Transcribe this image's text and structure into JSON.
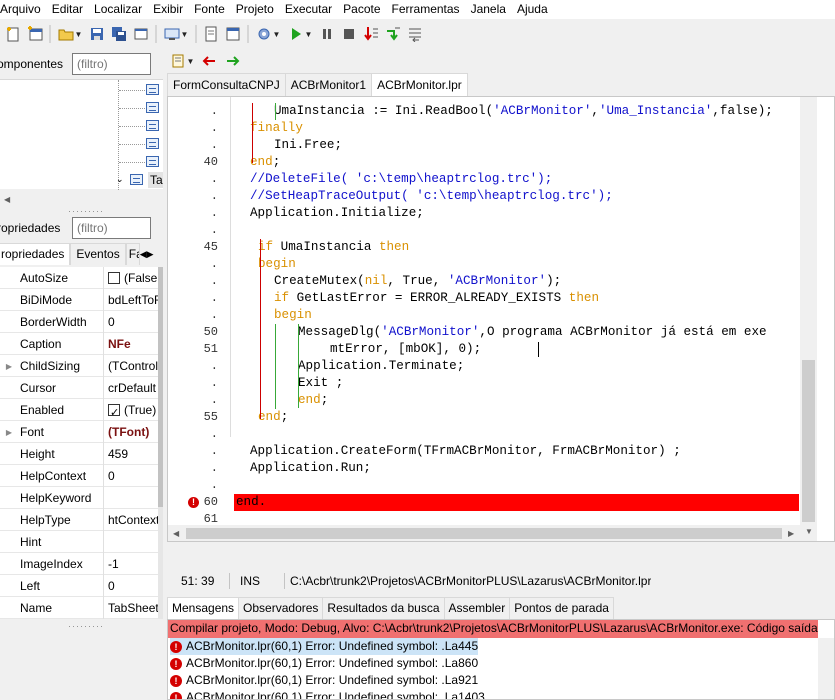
{
  "menu": [
    "Arquivo",
    "Editar",
    "Localizar",
    "Exibir",
    "Fonte",
    "Projeto",
    "Executar",
    "Pacote",
    "Ferramentas",
    "Janela",
    "Ajuda"
  ],
  "toolbar": {
    "icons": [
      "new-unit-icon",
      "new-form-icon",
      "open-icon",
      "save-icon",
      "save-all-icon",
      "toggle-form-icon",
      "view-units-icon",
      "view-forms-icon",
      "change-build-mode-icon",
      "run-icon",
      "pause-icon",
      "stop-icon",
      "step-into-icon",
      "step-over-icon",
      "step-out-icon"
    ]
  },
  "components": {
    "label": "omponentes",
    "filter_placeholder": "(filtro)",
    "last_node_label": "Ta"
  },
  "properties": {
    "label": "ropriedades",
    "filter_placeholder": "(filtro)",
    "tabs": [
      "ropriedades",
      "Eventos",
      "Fa"
    ],
    "rows": [
      {
        "name": "AutoSize",
        "value": "(False",
        "checkbox": "off",
        "expandable": false
      },
      {
        "name": "BiDiMode",
        "value": "bdLeftToR",
        "expandable": false
      },
      {
        "name": "BorderWidth",
        "value": "0",
        "expandable": false
      },
      {
        "name": "Caption",
        "value": "NFe",
        "bold": true,
        "expandable": false
      },
      {
        "name": "ChildSizing",
        "value": "(TControlC",
        "expandable": true
      },
      {
        "name": "Cursor",
        "value": "crDefault",
        "expandable": false
      },
      {
        "name": "Enabled",
        "value": "(True)",
        "checkbox": "on",
        "expandable": false
      },
      {
        "name": "Font",
        "value": "(TFont)",
        "bold": true,
        "expandable": true
      },
      {
        "name": "Height",
        "value": "459",
        "expandable": false
      },
      {
        "name": "HelpContext",
        "value": "0",
        "expandable": false
      },
      {
        "name": "HelpKeyword",
        "value": "",
        "expandable": false
      },
      {
        "name": "HelpType",
        "value": "htContext",
        "expandable": false
      },
      {
        "name": "Hint",
        "value": "",
        "expandable": false
      },
      {
        "name": "ImageIndex",
        "value": "-1",
        "expandable": false
      },
      {
        "name": "Left",
        "value": "0",
        "expandable": false
      },
      {
        "name": "Name",
        "value": "TabSheetI",
        "expandable": false
      }
    ]
  },
  "editor": {
    "tabs": [
      "FormConsultaCNPJ",
      "ACBrMonitor1",
      "ACBrMonitor.lpr"
    ],
    "active_tab": 2,
    "gutter": [
      ".",
      ".",
      ".",
      "40",
      ".",
      ".",
      ".",
      ".",
      "45",
      ".",
      ".",
      ".",
      ".",
      "50",
      "51",
      ".",
      ".",
      ".",
      "55",
      ".",
      ".",
      ".",
      ".",
      "60",
      "61"
    ],
    "error_line_number": "60",
    "error_line_text": "end.",
    "lines": [
      "UmaInstancia := Ini.ReadBool('ACBrMonitor','Uma_Instancia',false);",
      "finally",
      "Ini.Free;",
      "end;",
      "//DeleteFile( 'c:\\temp\\heaptrclog.trc');",
      "//SetHeapTraceOutput( 'c:\\temp\\heaptrclog.trc');",
      "Application.Initialize;",
      "",
      "if UmaInstancia then",
      "begin",
      "CreateMutex(nil, True, 'ACBrMonitor');",
      "if GetLastError = ERROR_ALREADY_EXISTS then",
      "begin",
      "MessageDlg('ACBrMonitor','O programa ACBrMonitor já está em exe",
      "mtError, [mbOK], 0);",
      "Application.Terminate;",
      "Exit ;",
      "end;",
      "end;",
      "",
      "Application.CreateForm(TFrmACBrMonitor, FrmACBrMonitor) ;",
      "Application.Run;",
      "",
      "end.",
      ""
    ]
  },
  "status": {
    "position": "51: 39",
    "mode": "INS",
    "path": "C:\\Acbr\\trunk2\\Projetos\\ACBrMonitorPLUS\\Lazarus\\ACBrMonitor.lpr"
  },
  "messages": {
    "tabs": [
      "Mensagens",
      "Observadores",
      "Resultados da busca",
      "Assembler",
      "Pontos de parada"
    ],
    "header": "Compilar projeto, Modo: Debug, Alvo: C:\\Acbr\\trunk2\\Projetos\\ACBrMonitorPLUS\\Lazarus\\ACBrMonitor.exe: Código saída",
    "items": [
      "ACBrMonitor.lpr(60,1) Error: Undefined symbol: .La445",
      "ACBrMonitor.lpr(60,1) Error: Undefined symbol: .La860",
      "ACBrMonitor.lpr(60,1) Error: Undefined symbol: .La921",
      "ACBrMonitor.lpr(60,1) Error: Undefined symbol: .La1403"
    ]
  },
  "colors": {
    "error_line": "#ff0000",
    "message_header": "#f07070",
    "keyword": "#d99000",
    "string": "#1010cc",
    "comment": "#1010cc",
    "selected_message": "#cce4f7"
  }
}
